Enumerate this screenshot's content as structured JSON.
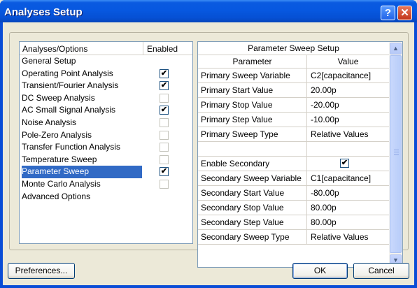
{
  "window": {
    "title": "Analyses Setup",
    "help_glyph": "?",
    "close_glyph": "✕"
  },
  "left": {
    "col_option": "Analyses/Options",
    "col_enabled": "Enabled",
    "items": [
      {
        "label": "General Setup",
        "has_check": false,
        "checked": false,
        "selected": false
      },
      {
        "label": "Operating Point Analysis",
        "has_check": true,
        "checked": true,
        "selected": false
      },
      {
        "label": "Transient/Fourier Analysis",
        "has_check": true,
        "checked": true,
        "selected": false
      },
      {
        "label": "DC Sweep Analysis",
        "has_check": true,
        "checked": false,
        "selected": false
      },
      {
        "label": "AC Small Signal Analysis",
        "has_check": true,
        "checked": true,
        "selected": false
      },
      {
        "label": "Noise Analysis",
        "has_check": true,
        "checked": false,
        "selected": false
      },
      {
        "label": "Pole-Zero Analysis",
        "has_check": true,
        "checked": false,
        "selected": false
      },
      {
        "label": "Transfer Function Analysis",
        "has_check": true,
        "checked": false,
        "selected": false
      },
      {
        "label": "Temperature Sweep",
        "has_check": true,
        "checked": false,
        "selected": false
      },
      {
        "label": "Parameter Sweep",
        "has_check": true,
        "checked": true,
        "selected": true
      },
      {
        "label": "Monte Carlo Analysis",
        "has_check": true,
        "checked": false,
        "selected": false
      },
      {
        "label": "Advanced Options",
        "has_check": false,
        "checked": false,
        "selected": false
      }
    ]
  },
  "right": {
    "title": "Parameter Sweep Setup",
    "col_param": "Parameter",
    "col_value": "Value",
    "rows": [
      {
        "param": "Primary Sweep Variable",
        "value": "C2[capacitance]"
      },
      {
        "param": "Primary Start Value",
        "value": "20.00p"
      },
      {
        "param": "Primary Stop Value",
        "value": "-20.00p"
      },
      {
        "param": "Primary Step Value",
        "value": "-10.00p"
      },
      {
        "param": "Primary Sweep Type",
        "value": "Relative Values"
      },
      {
        "param": "",
        "value": ""
      },
      {
        "param": "Enable Secondary",
        "value": "",
        "checkbox": true,
        "checked": true
      },
      {
        "param": "Secondary Sweep Variable",
        "value": "C1[capacitance]"
      },
      {
        "param": "Secondary Start Value",
        "value": "-80.00p"
      },
      {
        "param": "Secondary Stop Value",
        "value": "80.00p"
      },
      {
        "param": "Secondary Step Value",
        "value": "80.00p"
      },
      {
        "param": "Secondary Sweep Type",
        "value": "Relative Values"
      }
    ]
  },
  "buttons": {
    "preferences": "Preferences...",
    "ok": "OK",
    "cancel": "Cancel"
  },
  "check_glyph": "✔",
  "colors": {
    "selection": "#316ac5",
    "titlebar": "#0650d4"
  }
}
